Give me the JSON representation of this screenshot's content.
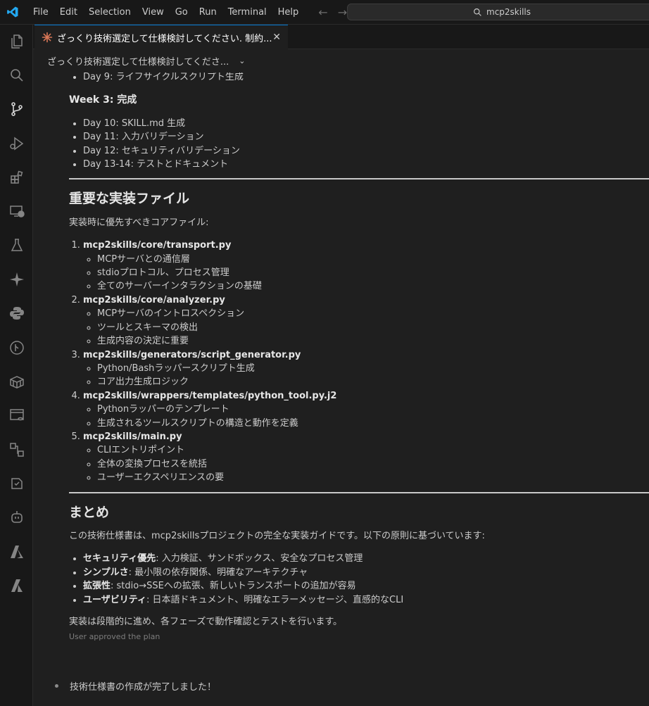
{
  "menu": [
    "File",
    "Edit",
    "Selection",
    "View",
    "Go",
    "Run",
    "Terminal",
    "Help"
  ],
  "search": {
    "text": "mcp2skills"
  },
  "tab": {
    "title": "ざっくり技術選定して仕様検討してください. 制約...",
    "close": "✕"
  },
  "breadcrumb": {
    "title": "ざっくり技術選定して仕様検討してくださ..."
  },
  "content": {
    "day9": "Day 9: ライフサイクルスクリプト生成",
    "week3": "Week 3: 完成",
    "week3_items": [
      "Day 10: SKILL.md 生成",
      "Day 11: 入力バリデーション",
      "Day 12: セキュリティバリデーション",
      "Day 13-14: テストとドキュメント"
    ],
    "h_files": "重要な実装ファイル",
    "files_intro": "実装時に優先すべきコアファイル:",
    "files": [
      {
        "name": "mcp2skills/core/transport.py",
        "sub": [
          "MCPサーバとの通信層",
          "stdioプロトコル、プロセス管理",
          "全てのサーバーインタラクションの基礎"
        ]
      },
      {
        "name": "mcp2skills/core/analyzer.py",
        "sub": [
          "MCPサーバのイントロスペクション",
          "ツールとスキーマの検出",
          "生成内容の決定に重要"
        ]
      },
      {
        "name": "mcp2skills/generators/script_generator.py",
        "sub": [
          "Python/Bashラッパースクリプト生成",
          "コア出力生成ロジック"
        ]
      },
      {
        "name": "mcp2skills/wrappers/templates/python_tool.py.j2",
        "sub": [
          "Pythonラッパーのテンプレート",
          "生成されるツールスクリプトの構造と動作を定義"
        ]
      },
      {
        "name": "mcp2skills/main.py",
        "sub": [
          "CLIエントリポイント",
          "全体の変換プロセスを統括",
          "ユーザーエクスペリエンスの要"
        ]
      }
    ],
    "h_summary": "まとめ",
    "summary_intro": "この技術仕様書は、mcp2skillsプロジェクトの完全な実装ガイドです。以下の原則に基づいています:",
    "principles": [
      {
        "label": "セキュリティ優先",
        "text": ": 入力検証、サンドボックス、安全なプロセス管理"
      },
      {
        "label": "シンプルさ",
        "text": ": 最小限の依存関係、明確なアーキテクチャ"
      },
      {
        "label": "拡張性",
        "text": ": stdio→SSEへの拡張、新しいトランスポートの追加が容易"
      },
      {
        "label": "ユーザビリティ",
        "text": ": 日本語ドキュメント、明確なエラーメッセージ、直感的なCLI"
      }
    ],
    "closing": "実装は段階的に進め、各フェーズで動作確認とテストを行います。",
    "approved": "User approved the plan",
    "final": "技術仕様書の作成が完了しました！"
  },
  "icons": [
    "files-icon",
    "search-icon",
    "source-control-icon",
    "run-debug-icon",
    "extensions-icon",
    "remote-explorer-icon",
    "testing-icon",
    "copilot-icon",
    "python-icon",
    "git-graph-icon",
    "containers-icon",
    "database-icon",
    "workflow-icon",
    "notebook-icon",
    "robot-icon",
    "azure-icon",
    "azure-tools-icon"
  ],
  "colors": {
    "accent": "#0078d4",
    "logo": "#23a9f2",
    "tab_icon": "#d97757"
  }
}
